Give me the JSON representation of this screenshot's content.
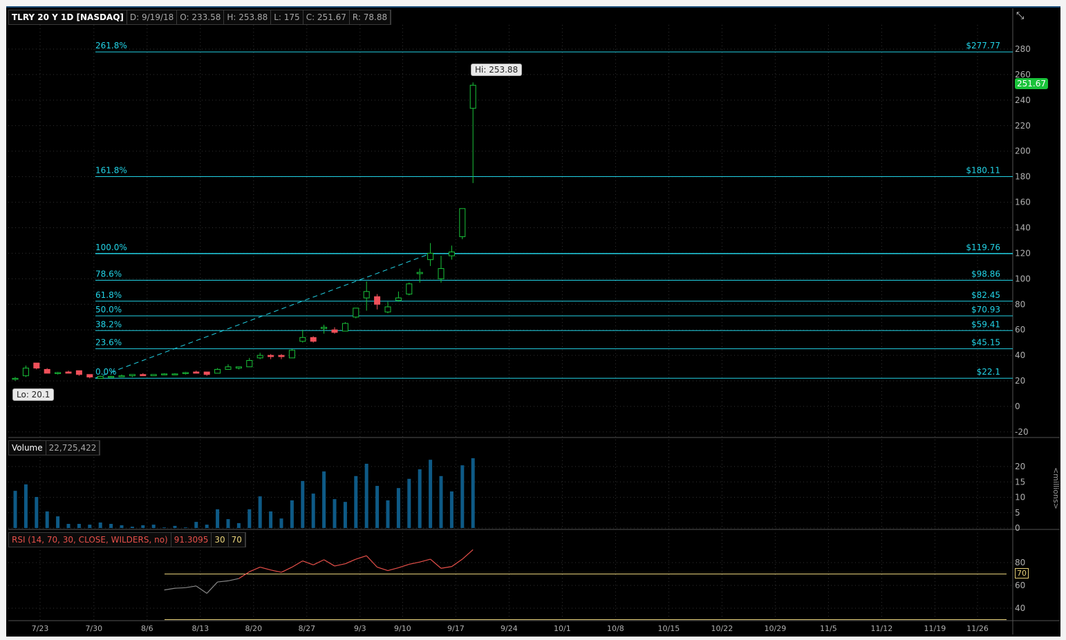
{
  "header": {
    "symbol": "TLRY 20 Y 1D [NASDAQ]",
    "date": "D: 9/19/18",
    "open": "O: 233.58",
    "high": "H: 253.88",
    "low": "L: 175",
    "close": "C: 251.67",
    "range": "R: 78.88"
  },
  "last_price": "251.67",
  "hi_label": "Hi: 253.88",
  "lo_label": "Lo: 20.1",
  "volume_header": {
    "label": "Volume",
    "value": "22,725,422"
  },
  "rsi_header": {
    "label": "RSI (14, 70, 30, CLOSE, WILDERS, no)",
    "value": "91.3095",
    "oversold": "30",
    "overbought": "70"
  },
  "rsi_tag": "70",
  "volume_unit": "<millions>",
  "colors": {
    "up": "#19c33a",
    "down": "#f0505a",
    "fib": "#22d3e6",
    "volume": "#0e5a86",
    "rsi": "#e8504a",
    "rsi_low": "#888888",
    "levels": "#e8d27a"
  },
  "chart_data": [
    {
      "type": "candlestick",
      "title": "TLRY 20 Y 1D [NASDAQ]",
      "ylim": [
        -20,
        290
      ],
      "yticks": [
        280,
        260,
        240,
        220,
        200,
        180,
        160,
        140,
        120,
        100,
        80,
        60,
        40,
        20,
        0,
        -20
      ],
      "xticks": [
        {
          "label": "7/23",
          "day": 2
        },
        {
          "label": "7/30",
          "day": 7
        },
        {
          "label": "8/6",
          "day": 12
        },
        {
          "label": "8/13",
          "day": 17
        },
        {
          "label": "8/20",
          "day": 22
        },
        {
          "label": "8/27",
          "day": 27
        },
        {
          "label": "9/3",
          "day": 32
        },
        {
          "label": "9/10",
          "day": 36
        },
        {
          "label": "9/17",
          "day": 41
        },
        {
          "label": "9/24",
          "day": 46
        },
        {
          "label": "10/1",
          "day": 51
        },
        {
          "label": "10/8",
          "day": 56
        },
        {
          "label": "10/15",
          "day": 61
        },
        {
          "label": "10/22",
          "day": 66
        },
        {
          "label": "10/29",
          "day": 71
        },
        {
          "label": "11/5",
          "day": 76
        },
        {
          "label": "11/12",
          "day": 81
        },
        {
          "label": "11/19",
          "day": 86
        },
        {
          "label": "11/26",
          "day": 90
        }
      ],
      "ohlc": [
        [
          22,
          23,
          20.1,
          22
        ],
        [
          24,
          32,
          23,
          30
        ],
        [
          34,
          34,
          29,
          30
        ],
        [
          29,
          30,
          26,
          26
        ],
        [
          26,
          27,
          25,
          26.5
        ],
        [
          27,
          28,
          26,
          26
        ],
        [
          28,
          28,
          24,
          25
        ],
        [
          25,
          25,
          22,
          23
        ],
        [
          22,
          24,
          22,
          23.5
        ],
        [
          23,
          24,
          22.5,
          23.5
        ],
        [
          24,
          25,
          23,
          24
        ],
        [
          24,
          25,
          23,
          25
        ],
        [
          25,
          26,
          24,
          24
        ],
        [
          24,
          25,
          24,
          25
        ],
        [
          25,
          26,
          24.5,
          25.5
        ],
        [
          25,
          26,
          25,
          25.5
        ],
        [
          26,
          27,
          25,
          26.5
        ],
        [
          27,
          28,
          26,
          26
        ],
        [
          27,
          27,
          24,
          25
        ],
        [
          26,
          30,
          26,
          29
        ],
        [
          29,
          33,
          29,
          31
        ],
        [
          30,
          31,
          29,
          31
        ],
        [
          31,
          38,
          31,
          36
        ],
        [
          38,
          42,
          37,
          40
        ],
        [
          40,
          41,
          37,
          39
        ],
        [
          40,
          41,
          37,
          39
        ],
        [
          38,
          45,
          38,
          44
        ],
        [
          51,
          60,
          50,
          54
        ],
        [
          54,
          55,
          50,
          51
        ],
        [
          61,
          64,
          57,
          62
        ],
        [
          60,
          62,
          57,
          58
        ],
        [
          59,
          66,
          59,
          65
        ],
        [
          70,
          77,
          69,
          77
        ],
        [
          85,
          98,
          75,
          90
        ],
        [
          86,
          88,
          76,
          80
        ],
        [
          74,
          82,
          73,
          78
        ],
        [
          83,
          90,
          82,
          85
        ],
        [
          88,
          97,
          87,
          96
        ],
        [
          104,
          108,
          97,
          105
        ],
        [
          115,
          128,
          110,
          120
        ],
        [
          100,
          118,
          97,
          108
        ],
        [
          118,
          126,
          115,
          121
        ],
        [
          133,
          155,
          131,
          155
        ],
        [
          233.58,
          253.88,
          175,
          251.67
        ]
      ],
      "fib_levels": [
        {
          "pct": "261.8%",
          "price": 277.77,
          "label": "$277.77"
        },
        {
          "pct": "161.8%",
          "price": 180.11,
          "label": "$180.11"
        },
        {
          "pct": "100.0%",
          "price": 119.76,
          "label": "$119.76"
        },
        {
          "pct": "78.6%",
          "price": 98.86,
          "label": "$98.86"
        },
        {
          "pct": "61.8%",
          "price": 82.45,
          "label": "$82.45"
        },
        {
          "pct": "50.0%",
          "price": 70.93,
          "label": "$70.93"
        },
        {
          "pct": "38.2%",
          "price": 59.41,
          "label": "$59.41"
        },
        {
          "pct": "23.6%",
          "price": 45.15,
          "label": "$45.15"
        },
        {
          "pct": "0.0%",
          "price": 22.1,
          "label": "$22.1"
        }
      ],
      "fib_trendline": {
        "from": {
          "day": 7.5,
          "price": 22.1
        },
        "to": {
          "day": 39,
          "price": 119.76
        }
      }
    },
    {
      "type": "bar",
      "title": "Volume",
      "ylabel": "millions",
      "ylim": [
        0,
        25
      ],
      "yticks": [
        20,
        15,
        10,
        5,
        0
      ],
      "values": [
        12.1,
        14.2,
        10.1,
        5.4,
        3.8,
        1.35,
        1.35,
        1.1,
        1.8,
        1.35,
        0.9,
        0.45,
        0.9,
        1.1,
        0.2,
        0.7,
        0.2,
        2.0,
        1.1,
        6.1,
        2.9,
        1.6,
        6.1,
        10.3,
        5.4,
        3.1,
        9.0,
        15.3,
        11.2,
        18.4,
        9.4,
        8.5,
        16.9,
        20.9,
        13.7,
        9.0,
        13.0,
        16.0,
        19.1,
        22.2,
        16.9,
        11.9,
        20.4,
        22.7
      ]
    },
    {
      "type": "line",
      "title": "RSI (14, 70, 30, CLOSE, WILDERS, no)",
      "ylim": [
        25,
        95
      ],
      "yticks": [
        80,
        60,
        40
      ],
      "levels": [
        70,
        30
      ],
      "start_day": 14,
      "values": [
        56,
        57.5,
        58,
        59.5,
        53,
        63,
        64,
        66,
        72,
        76,
        73.5,
        71.5,
        76,
        81.5,
        78,
        82.5,
        77,
        79,
        83,
        86,
        76,
        73,
        75.5,
        78.5,
        80.5,
        83,
        75,
        76.5,
        83,
        91.3
      ]
    }
  ]
}
